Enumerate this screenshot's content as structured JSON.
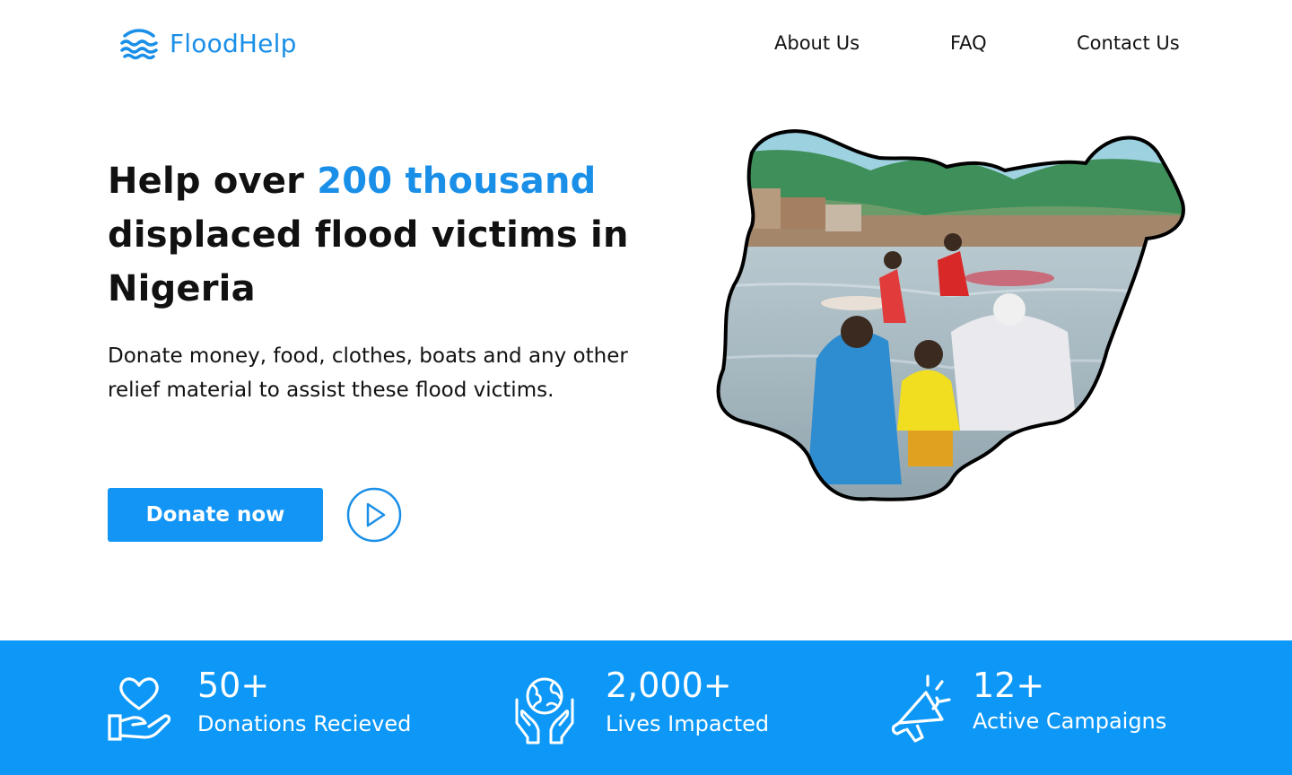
{
  "brand": {
    "name": "FloodHelp",
    "logo_icon": "waves-icon"
  },
  "nav": {
    "items": [
      "About Us",
      "FAQ",
      "Contact Us"
    ]
  },
  "hero": {
    "title_prefix": "Help over ",
    "title_accent": "200 thousand",
    "title_suffix": "displaced flood victims in Nigeria",
    "subtitle": "Donate money, food, clothes, boats and any other relief material to assist these flood victims.",
    "cta_label": "Donate now",
    "play_icon": "play-icon",
    "image_icon": "nigeria-map-photo"
  },
  "stats": [
    {
      "value": "50+",
      "label": "Donations Recieved",
      "icon": "heart-hand-icon"
    },
    {
      "value": "2,000+",
      "label": "Lives Impacted",
      "icon": "globe-hands-icon"
    },
    {
      "value": "12+",
      "label": "Active Campaigns",
      "icon": "megaphone-icon"
    }
  ],
  "colors": {
    "brand_blue": "#1a8fe8",
    "button_blue": "#1395f5",
    "stats_bg": "#0d98f7",
    "text": "#111111"
  }
}
